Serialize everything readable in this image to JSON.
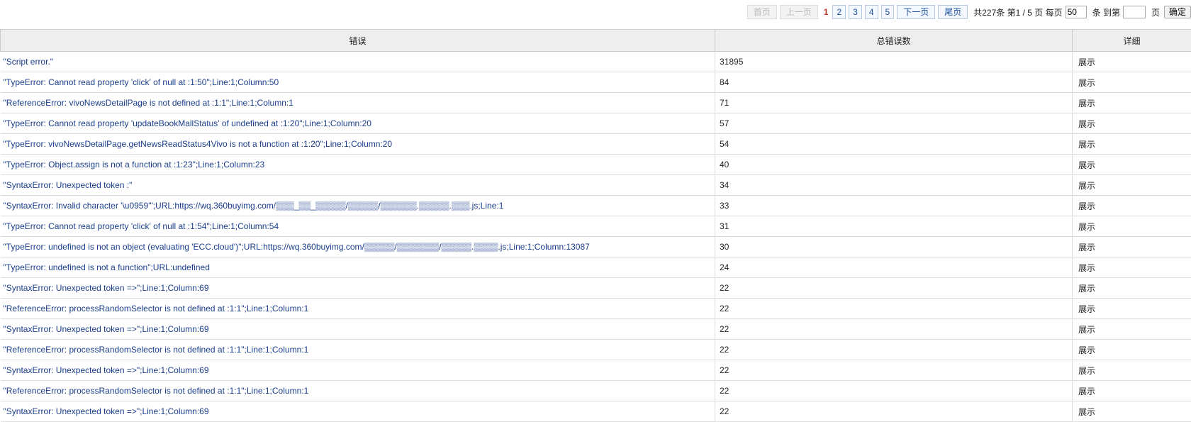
{
  "pager": {
    "first": "首页",
    "prev": "上一页",
    "current": "1",
    "pages": [
      "2",
      "3",
      "4",
      "5"
    ],
    "next": "下一页",
    "last": "尾页",
    "summary": "共227条 第1 / 5 页 每页",
    "per_page": "50",
    "unit": "条 到第",
    "page_suffix": "页",
    "jump_value": "",
    "confirm": "确定"
  },
  "table": {
    "headers": [
      "错误",
      "总错误数",
      "详细"
    ],
    "detail_label": "展示",
    "rows": [
      {
        "msg": "\"Script error.\"",
        "count": "31895"
      },
      {
        "msg": "\"TypeError: Cannot read property 'click' of null at :1:50\";Line:1;Column:50",
        "count": "84"
      },
      {
        "msg": "\"ReferenceError: vivoNewsDetailPage is not defined at :1:1\";Line:1;Column:1",
        "count": "71"
      },
      {
        "msg": "\"TypeError: Cannot read property 'updateBookMallStatus' of undefined at :1:20\";Line:1;Column:20",
        "count": "57"
      },
      {
        "msg": "\"TypeError: vivoNewsDetailPage.getNewsReadStatus4Vivo is not a function at :1:20\";Line:1;Column:20",
        "count": "54"
      },
      {
        "msg": "\"TypeError: Object.assign is not a function at :1:23\";Line:1;Column:23",
        "count": "40"
      },
      {
        "msg": "\"SyntaxError: Unexpected token :\"",
        "count": "34"
      },
      {
        "msg": "\"SyntaxError: Invalid character '\\u0959'\";URL:https://wq.360buyimg.com/▒▒▒_▒▒_▒▒▒▒▒/▒▒▒▒▒/▒▒▒▒▒▒.▒▒▒▒▒.▒▒▒.js;Line:1",
        "count": "33"
      },
      {
        "msg": "\"TypeError: Cannot read property 'click' of null at :1:54\";Line:1;Column:54",
        "count": "31"
      },
      {
        "msg": "\"TypeError: undefined is not an object (evaluating 'ECC.cloud')\";URL:https://wq.360buyimg.com/▒▒▒▒▒/▒▒▒▒▒▒▒/▒▒▒▒▒.▒▒▒▒.js;Line:1;Column:13087",
        "count": "30"
      },
      {
        "msg": "\"TypeError: undefined is not a function\";URL:undefined",
        "count": "24"
      },
      {
        "msg": "\"SyntaxError: Unexpected token =>\";Line:1;Column:69",
        "count": "22"
      },
      {
        "msg": "\"ReferenceError: processRandomSelector is not defined at :1:1\";Line:1;Column:1",
        "count": "22"
      },
      {
        "msg": "\"SyntaxError: Unexpected token =>\";Line:1;Column:69",
        "count": "22"
      },
      {
        "msg": "\"ReferenceError: processRandomSelector is not defined at :1:1\";Line:1;Column:1",
        "count": "22"
      },
      {
        "msg": "\"SyntaxError: Unexpected token =>\";Line:1;Column:69",
        "count": "22"
      },
      {
        "msg": "\"ReferenceError: processRandomSelector is not defined at :1:1\";Line:1;Column:1",
        "count": "22"
      },
      {
        "msg": "\"SyntaxError: Unexpected token =>\";Line:1;Column:69",
        "count": "22"
      }
    ]
  }
}
